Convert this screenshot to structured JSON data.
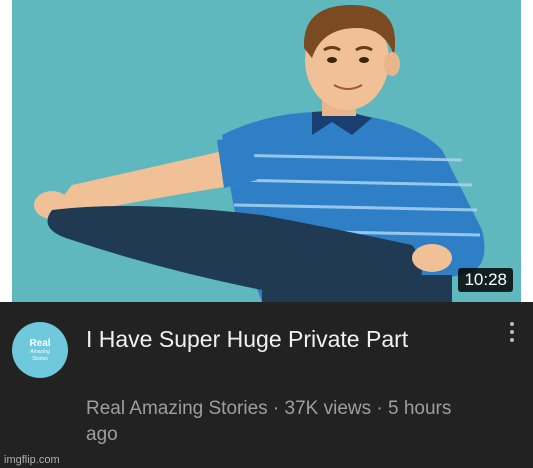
{
  "video": {
    "duration": "10:28",
    "title": "I Have Super Huge Private Part",
    "channel": "Real Amazing Stories",
    "views": "37K views",
    "age": "5 hours ago",
    "meta_line": "Real Amazing Stories · 37K views · 5 hours ago"
  },
  "avatar": {
    "line1": "Real",
    "line2": "Amazing",
    "line3": "Stories"
  },
  "watermark": "imgflip.com",
  "icons": {
    "menu": "more-vertical-icon"
  },
  "colors": {
    "thumbnail_bg": "#5fb8bd",
    "info_bg": "#222222",
    "shirt": "#2f7fc7",
    "avatar_bg": "#6ec9dd"
  }
}
